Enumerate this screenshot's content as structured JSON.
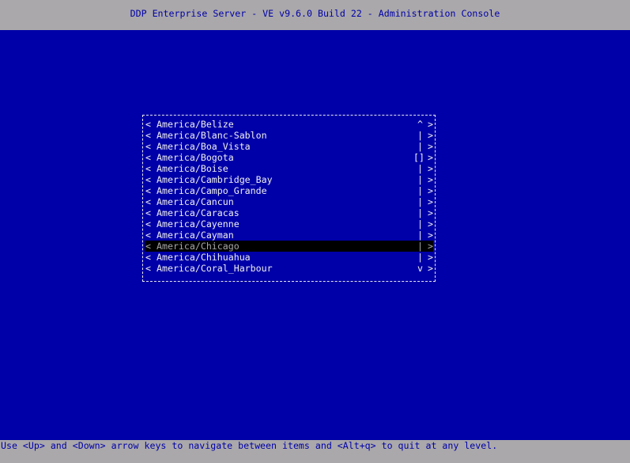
{
  "header": {
    "title": "DDP Enterprise Server - VE v9.6.0 Build 22 - Administration Console"
  },
  "list": {
    "items": [
      {
        "label": "America/Belize",
        "scroll": "^"
      },
      {
        "label": "America/Blanc-Sablon",
        "scroll": "|"
      },
      {
        "label": "America/Boa_Vista",
        "scroll": "|"
      },
      {
        "label": "America/Bogota",
        "scroll": "[]"
      },
      {
        "label": "America/Boise",
        "scroll": "|"
      },
      {
        "label": "America/Cambridge_Bay",
        "scroll": "|"
      },
      {
        "label": "America/Campo_Grande",
        "scroll": "|"
      },
      {
        "label": "America/Cancun",
        "scroll": "|"
      },
      {
        "label": "America/Caracas",
        "scroll": "|"
      },
      {
        "label": "America/Cayenne",
        "scroll": "|"
      },
      {
        "label": "America/Cayman",
        "scroll": "|"
      },
      {
        "label": "America/Chicago",
        "scroll": "|"
      },
      {
        "label": "America/Chihuahua",
        "scroll": "|"
      },
      {
        "label": "America/Coral_Harbour",
        "scroll": "v"
      }
    ],
    "selected": "America/Chicago",
    "left_marker": "<",
    "right_marker": ">"
  },
  "footer": {
    "help": "Use <Up> and <Down> arrow keys to navigate between items and <Alt+q> to quit at any level."
  },
  "colors": {
    "background": "#0000a8",
    "bar": "#aaa8aa",
    "highlight": "#000000"
  }
}
